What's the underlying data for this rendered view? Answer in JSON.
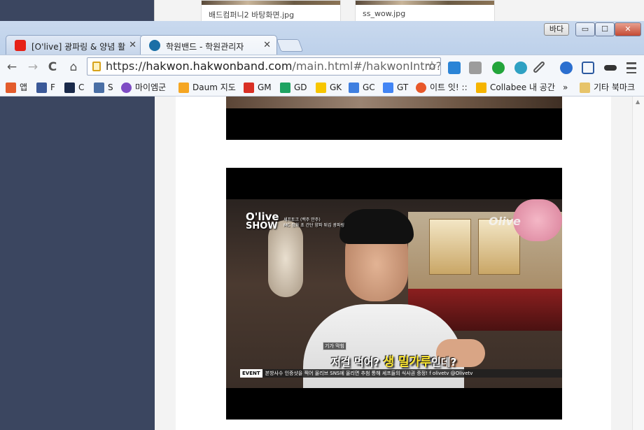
{
  "background_window": {
    "thumbs": [
      "배드컴퍼니2 바탕화면.jpg",
      "ss_wow.jpg"
    ]
  },
  "window": {
    "user_badge": "바다",
    "minimize": "▭",
    "maximize": "☐",
    "close": "✕"
  },
  "tabs": [
    {
      "title": "[O'live] 광파링 & 양념 활",
      "favicon_color": "#e62117",
      "favicon": "youtube-icon",
      "close": "✕"
    },
    {
      "title": "학원밴드 - 학원관리자",
      "favicon_color": "#1b6fa6",
      "favicon": "clock-icon",
      "close": "✕"
    }
  ],
  "toolbar": {
    "back": "←",
    "forward": "→",
    "reload": "C",
    "home": "⌂",
    "url_proto": "https://",
    "url_host": "hakwon.hakwonband.com",
    "url_rest": "/main.html#/hakwonIntro?hal",
    "star": "☆"
  },
  "extensions": [
    {
      "name": "ext-p-icon",
      "color": "#2b84d6"
    },
    {
      "name": "ext-in-icon",
      "color": "#9c9c9c"
    },
    {
      "name": "ext-leaf-icon",
      "color": "#23a53b"
    },
    {
      "name": "ext-m-icon",
      "color": "#2fa1c3"
    },
    {
      "name": "eyedropper-icon",
      "color": "#555555"
    },
    {
      "name": "download-icon",
      "color": "#2b6fcf"
    },
    {
      "name": "screenshot-icon",
      "color": "#2c5aa0"
    },
    {
      "name": "mask-icon",
      "color": "#333333"
    },
    {
      "name": "menu-icon",
      "color": "#555555"
    }
  ],
  "bookmarks": [
    {
      "label": "앱",
      "icon": "apps-icon",
      "color": "#e35c2c"
    },
    {
      "label": "F",
      "icon": "facebook-icon",
      "color": "#3b5998"
    },
    {
      "label": "C",
      "icon": "c-icon",
      "color": "#1a2a4a"
    },
    {
      "label": "S",
      "icon": "s-icon",
      "color": "#4a6fa5"
    },
    {
      "label": "마이엠군",
      "icon": "chrome-icon",
      "color": "#7e4cc4"
    },
    {
      "label": "Daum 지도",
      "icon": "daum-icon",
      "color": "#f5a623"
    },
    {
      "label": "GM",
      "icon": "gmail-icon",
      "color": "#d93025"
    },
    {
      "label": "GD",
      "icon": "drive-icon",
      "color": "#1ea362"
    },
    {
      "label": "GK",
      "icon": "keep-icon",
      "color": "#f7c600"
    },
    {
      "label": "GC",
      "icon": "calendar-icon",
      "color": "#3f7fe0"
    },
    {
      "label": "GT",
      "icon": "translate-icon",
      "color": "#4285f4"
    },
    {
      "label": "이트 잇! ::",
      "icon": "eat-icon",
      "color": "#e8582a"
    },
    {
      "label": "Collabee 내 공간",
      "icon": "collabee-icon",
      "color": "#f5b400"
    },
    {
      "label": "»",
      "icon": "",
      "color": ""
    },
    {
      "label": "기타 북마크",
      "icon": "folder-icon",
      "color": "#e7c46a"
    }
  ],
  "video": {
    "logo_top": "O'live",
    "logo_bottom": "SHOW",
    "info_line1": "셰프토크 (백주 만주)",
    "info_line2": "MC 정화 초 간단 양파 튀김 광파링",
    "watermark": "Olive",
    "caption_tag": "기가 막힘",
    "caption_pre": "저걸 먹어? ",
    "caption_highlight": "생 밀가루",
    "caption_post": "인데?",
    "ticker_event": "EVENT",
    "ticker_text": "본방사수 인증샷을 찍어 올리브 SNS에 올리면 추첨 통해 셰프들의 식사권 증정!  f olivetv  @Olivetv"
  }
}
